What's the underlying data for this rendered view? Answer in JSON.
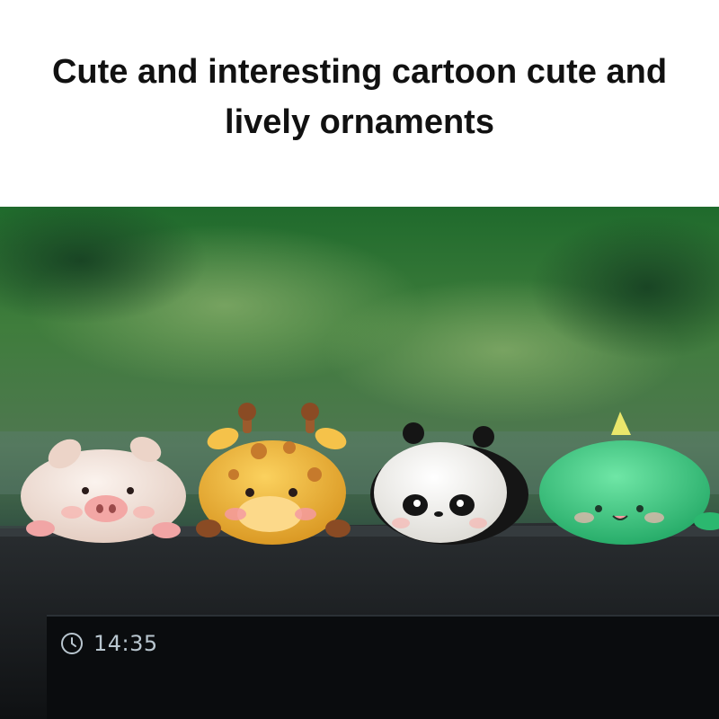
{
  "headline": {
    "line1": "Cute and interesting cartoon cute and",
    "line2": "lively ornaments"
  },
  "photo": {
    "figurines": [
      {
        "animal": "pig",
        "color": "#f3e6df"
      },
      {
        "animal": "giraffe",
        "color": "#f1b83a"
      },
      {
        "animal": "panda",
        "color": "#f4f3ef"
      },
      {
        "animal": "dinosaur",
        "color": "#3ec883"
      }
    ],
    "background_color": "#3d7a3a"
  },
  "dashboard_screen": {
    "icon": "clock-icon",
    "time": "14:35"
  }
}
